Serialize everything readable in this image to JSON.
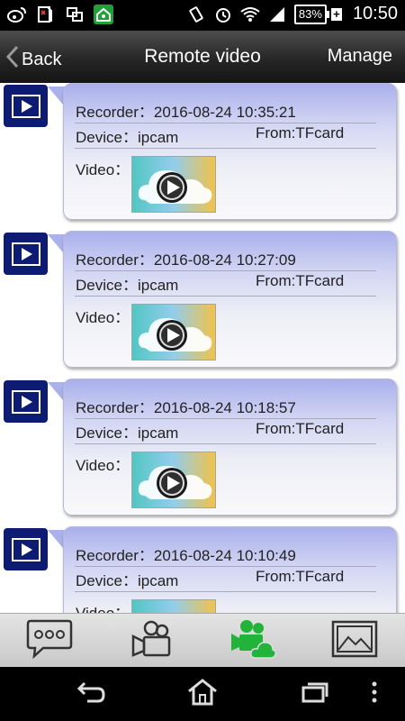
{
  "status_bar": {
    "icons": [
      "weibo-icon",
      "sim-no-data-icon",
      "screen-mirror-icon",
      "app-home-icon",
      "vibrate-icon",
      "alarm-icon",
      "wifi-icon",
      "signal-icon"
    ],
    "battery": "83%",
    "time": "10:50"
  },
  "header": {
    "back_label": "Back",
    "title": "Remote video",
    "manage_label": "Manage"
  },
  "recordings": [
    {
      "recorder_label": "Recorder：",
      "recorder_time": "2016-08-24 10:35:21",
      "device_label": "Device：",
      "device": "ipcam",
      "from_label": "From:",
      "from": "TFcard",
      "video_label": "Video："
    },
    {
      "recorder_label": "Recorder：",
      "recorder_time": "2016-08-24 10:27:09",
      "device_label": "Device：",
      "device": "ipcam",
      "from_label": "From:",
      "from": "TFcard",
      "video_label": "Video："
    },
    {
      "recorder_label": "Recorder：",
      "recorder_time": "2016-08-24 10:18:57",
      "device_label": "Device：",
      "device": "ipcam",
      "from_label": "From:",
      "from": "TFcard",
      "video_label": "Video："
    },
    {
      "recorder_label": "Recorder：",
      "recorder_time": "2016-08-24 10:10:49",
      "device_label": "Device：",
      "device": "ipcam",
      "from_label": "From:",
      "from": "TFcard",
      "video_label": "Video："
    }
  ],
  "tabs": [
    {
      "icon": "chat-bubble-icon",
      "active": false
    },
    {
      "icon": "video-camera-icon",
      "active": false
    },
    {
      "icon": "cloud-video-icon",
      "active": true
    },
    {
      "icon": "picture-icon",
      "active": false
    }
  ],
  "colors": {
    "accent_green": "#22b43a",
    "list_icon_bg": "#0d1c72",
    "bubble_top": "#a9b0eb"
  }
}
